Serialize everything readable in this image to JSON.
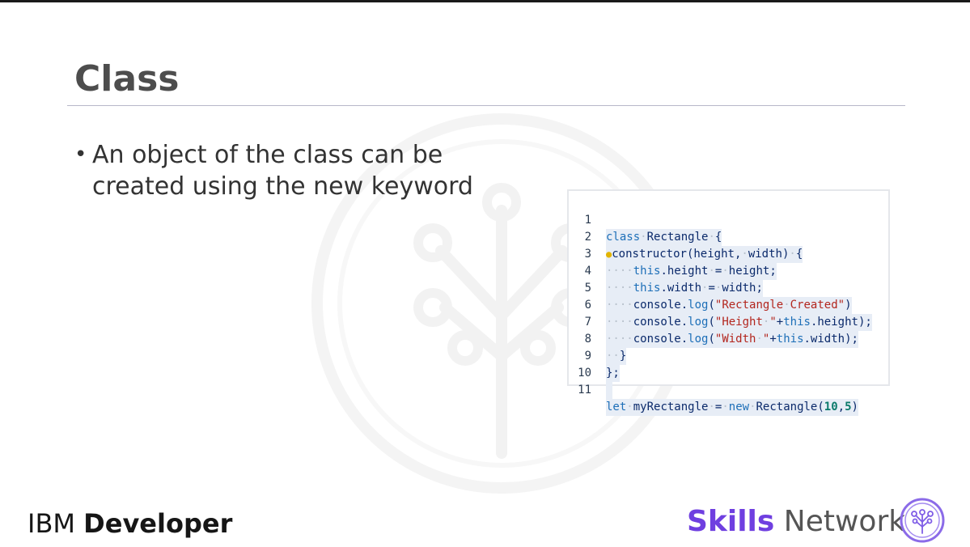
{
  "slide": {
    "title": "Class",
    "bullet": "An object of the class can be created using the new keyword"
  },
  "code": {
    "lines": [
      {
        "n": "1",
        "text": "class Rectangle {"
      },
      {
        "n": "2",
        "text": "constructor(height, width) {"
      },
      {
        "n": "3",
        "text": "this.height = height;"
      },
      {
        "n": "4",
        "text": "this.width = width;"
      },
      {
        "n": "5",
        "text": "console.log(\"Rectangle Created\")"
      },
      {
        "n": "6",
        "text": "console.log(\"Height \"+this.height);"
      },
      {
        "n": "7",
        "text": "console.log(\"Width \"+this.width);"
      },
      {
        "n": "8",
        "text": "}"
      },
      {
        "n": "9",
        "text": "};"
      },
      {
        "n": "10",
        "text": ""
      },
      {
        "n": "11",
        "text": "let myRectangle = new Rectangle(10,5)"
      }
    ]
  },
  "footer": {
    "ibm_prefix": "IBM",
    "ibm_bold": "Developer",
    "skills_bold": "Skills",
    "skills_rest": "Network"
  },
  "colors": {
    "accent_purple": "#6f3fe0",
    "code_keyword": "#1d6fb8",
    "code_string": "#b3261e",
    "code_number": "#0b7a6b"
  }
}
